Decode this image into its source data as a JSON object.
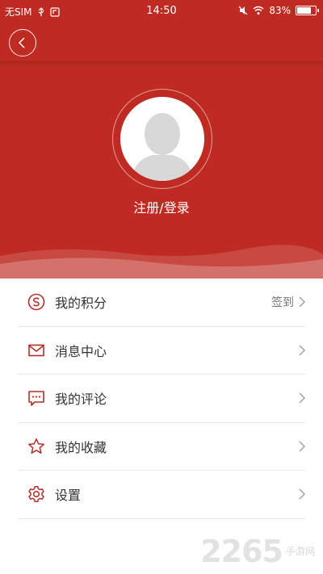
{
  "status_bar": {
    "carrier": "无SIM",
    "time": "14:50",
    "battery_text": "83%",
    "battery_level": 0.83
  },
  "header": {
    "back_icon": "chevron-left-icon"
  },
  "profile": {
    "login_text": "注册/登录",
    "avatar_icon": "default-avatar-icon"
  },
  "menu": {
    "items": [
      {
        "label": "我的积分",
        "icon": "points-icon",
        "extra": "签到"
      },
      {
        "label": "消息中心",
        "icon": "mail-icon",
        "extra": ""
      },
      {
        "label": "我的评论",
        "icon": "comment-icon",
        "extra": ""
      },
      {
        "label": "我的收藏",
        "icon": "star-icon",
        "extra": ""
      },
      {
        "label": "设置",
        "icon": "gear-icon",
        "extra": ""
      }
    ]
  },
  "watermark": {
    "logo": "2265",
    "small": "手游网"
  },
  "colors": {
    "brand_red": "#bf2a22",
    "icon_red": "#b3302a"
  }
}
